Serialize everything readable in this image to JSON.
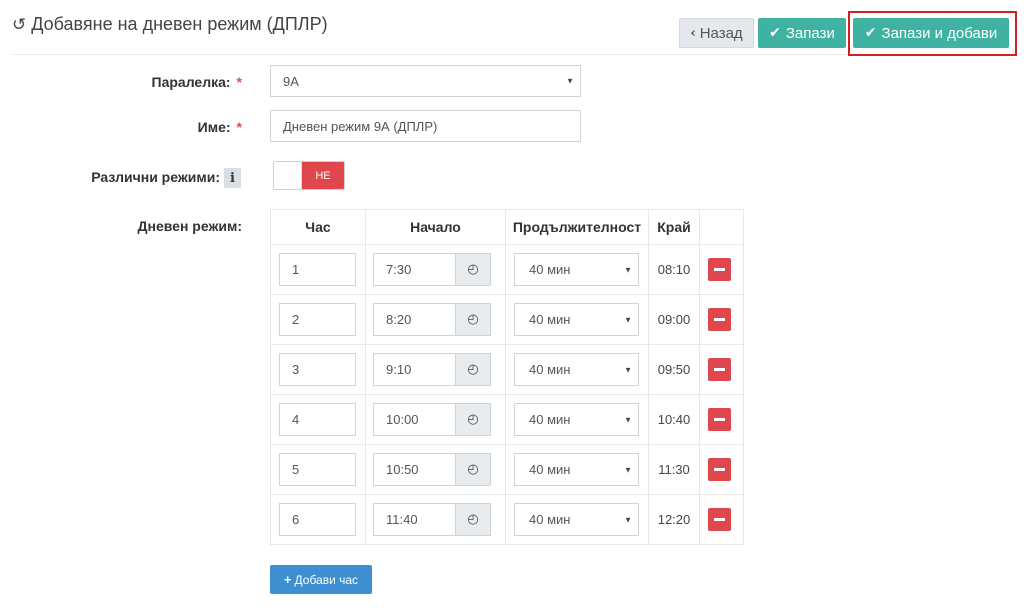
{
  "header": {
    "title": "Добавяне на дневен режим (ДПЛР)",
    "icon": "history-icon"
  },
  "toolbar": {
    "back_label": "Назад",
    "save_label": "Запази",
    "save_add_label": "Запази и добави",
    "highlight_color": "#d21f1f"
  },
  "form": {
    "class_label": "Паралелка:",
    "class_value": "9А",
    "name_label": "Име:",
    "name_value": "Дневен режим 9А (ДПЛР)",
    "required_mark": "*",
    "modes_label": "Различни режими:",
    "modes_info": "i",
    "modes_toggle": "НЕ",
    "schedule_label": "Дневен режим:"
  },
  "schedule": {
    "columns": [
      "Час",
      "Начало",
      "Продължителност",
      "Край",
      ""
    ],
    "rows": [
      {
        "hour": "1",
        "start": "7:30",
        "duration": "40 мин",
        "end": "08:10"
      },
      {
        "hour": "2",
        "start": "8:20",
        "duration": "40 мин",
        "end": "09:00"
      },
      {
        "hour": "3",
        "start": "9:10",
        "duration": "40 мин",
        "end": "09:50"
      },
      {
        "hour": "4",
        "start": "10:00",
        "duration": "40 мин",
        "end": "10:40"
      },
      {
        "hour": "5",
        "start": "10:50",
        "duration": "40 мин",
        "end": "11:30"
      },
      {
        "hour": "6",
        "start": "11:40",
        "duration": "40 мин",
        "end": "12:20"
      }
    ]
  },
  "add_hour_label": "Добави час",
  "colors": {
    "primary": "#3fb2a2",
    "danger": "#e0474c",
    "info": "#3d8fd1"
  }
}
